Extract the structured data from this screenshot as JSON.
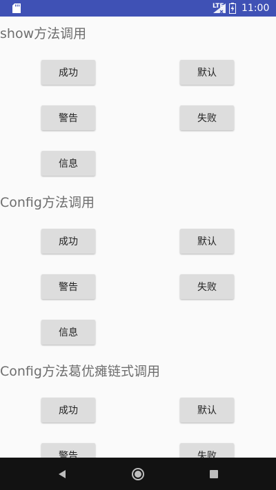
{
  "status_bar": {
    "time": "11:00",
    "network": "LTE",
    "icons": [
      "sd-card-icon",
      "signal-icon",
      "battery-icon"
    ]
  },
  "sections": [
    {
      "title": "show方法调用",
      "buttons": [
        "成功",
        "默认",
        "警告",
        "失败",
        "信息"
      ]
    },
    {
      "title": "Config方法调用",
      "buttons": [
        "成功",
        "默认",
        "警告",
        "失败",
        "信息"
      ]
    },
    {
      "title": "Config方法葛优瘫链式调用",
      "buttons": [
        "成功",
        "默认",
        "警告",
        "失败"
      ]
    }
  ],
  "nav_bar": {
    "icons": [
      "back-icon",
      "home-icon",
      "recents-icon"
    ]
  },
  "colors": {
    "status_bar": "#3f51b5",
    "background": "#fafafa",
    "button": "#dddddd",
    "title_text": "#6e6e6e",
    "nav_bar": "#121212"
  }
}
